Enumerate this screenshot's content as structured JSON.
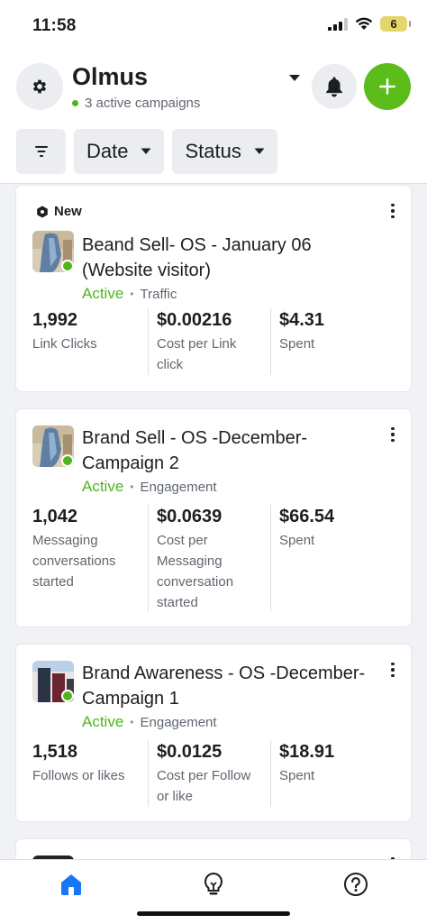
{
  "status_bar": {
    "time": "11:58",
    "battery": "6"
  },
  "header": {
    "account_name": "Olmus",
    "subtitle": "3 active campaigns"
  },
  "filters": {
    "date_label": "Date",
    "status_label": "Status"
  },
  "campaigns": [
    {
      "badge": "New",
      "title": "Beand Sell- OS - January 06 (Website visitor)",
      "status": "Active",
      "objective": "Traffic",
      "metrics": [
        {
          "value": "1,992",
          "label": "Link Clicks"
        },
        {
          "value": "$0.00216",
          "label": "Cost per Link click"
        },
        {
          "value": "$4.31",
          "label": "Spent"
        }
      ]
    },
    {
      "title": "Brand Sell - OS -December-Campaign 2",
      "status": "Active",
      "objective": "Engagement",
      "metrics": [
        {
          "value": "1,042",
          "label": "Messaging conversations started"
        },
        {
          "value": "$0.0639",
          "label": "Cost per Messaging conversation started"
        },
        {
          "value": "$66.54",
          "label": "Spent"
        }
      ]
    },
    {
      "title": "Brand Awareness - OS -December- Campaign 1",
      "status": "Active",
      "objective": "Engagement",
      "metrics": [
        {
          "value": "1,518",
          "label": "Follows or likes"
        },
        {
          "value": "$0.0125",
          "label": "Cost per Follow or like"
        },
        {
          "value": "$18.91",
          "label": "Spent"
        }
      ]
    }
  ],
  "tabs": [
    {
      "name": "home-icon",
      "active": true
    },
    {
      "name": "lightbulb-icon",
      "active": false
    },
    {
      "name": "help-icon",
      "active": false
    }
  ],
  "colors": {
    "accent_green": "#5cbc1a",
    "status_green": "#4fb51f",
    "tab_active": "#1877f2"
  }
}
